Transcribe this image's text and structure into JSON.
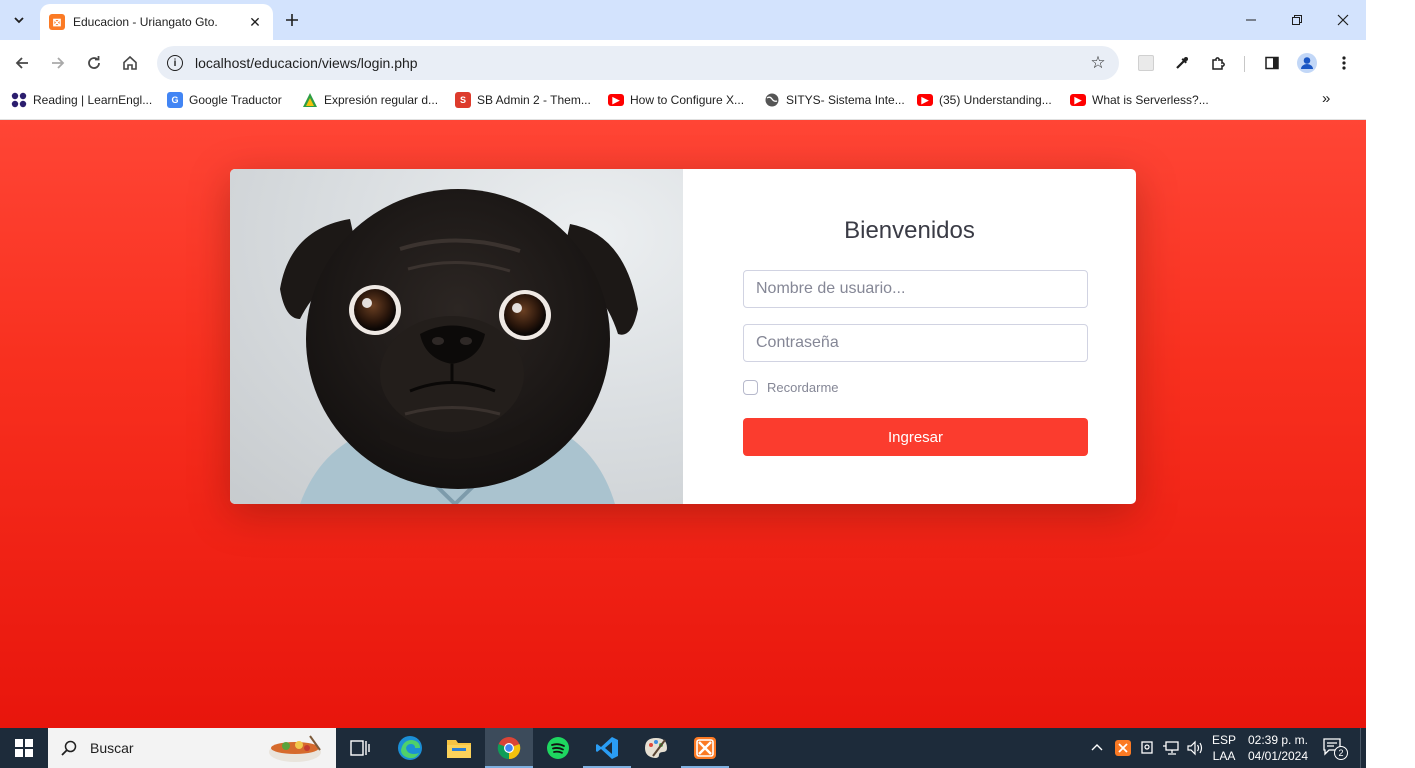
{
  "browser": {
    "tab": {
      "title": "Educacion - Uriangato Gto.",
      "favicon_icon": "xampp-icon"
    },
    "address_bar": {
      "url": "localhost/educacion/views/login.php"
    },
    "bookmarks": [
      {
        "label": "Reading | LearnEngl...",
        "icon": "learnenglish-icon",
        "color": "#2b1d6e"
      },
      {
        "label": "Google Traductor",
        "icon": "google-translate-icon",
        "color": "#4285f4"
      },
      {
        "label": "Expresión regular d...",
        "icon": "expression-icon",
        "color": "#2f9e44"
      },
      {
        "label": "SB Admin 2 - Them...",
        "icon": "startbootstrap-icon",
        "color": "#dd3b2c"
      },
      {
        "label": "How to Configure X...",
        "icon": "youtube-icon",
        "color": "#ff0000"
      },
      {
        "label": "SITYS- Sistema Inte...",
        "icon": "globe-icon",
        "color": "#555555"
      },
      {
        "label": "(35) Understanding...",
        "icon": "youtube-icon",
        "color": "#ff0000"
      },
      {
        "label": "What is Serverless?...",
        "icon": "youtube-icon",
        "color": "#ff0000"
      }
    ]
  },
  "login": {
    "title": "Bienvenidos",
    "username_placeholder": "Nombre de usuario...",
    "password_placeholder": "Contraseña",
    "remember_label": "Recordarme",
    "submit_label": "Ingresar",
    "image_subject": "pug-dog-photo"
  },
  "taskbar": {
    "search_placeholder": "Buscar",
    "apps": [
      "task-view-icon",
      "edge-icon",
      "file-explorer-icon",
      "chrome-icon",
      "spotify-icon",
      "vscode-icon",
      "paint-icon",
      "xampp-icon"
    ],
    "language": "ESP",
    "keyboard": "LAA",
    "time": "02:39 p. m.",
    "date": "04/01/2024",
    "notification_count": "2"
  },
  "colors": {
    "page_gradient_top": "#ff4535",
    "page_gradient_bottom": "#e8150c",
    "button": "#fb3c2e",
    "tabstrip": "#d3e3fd",
    "taskbar": "#1d2b3a"
  }
}
